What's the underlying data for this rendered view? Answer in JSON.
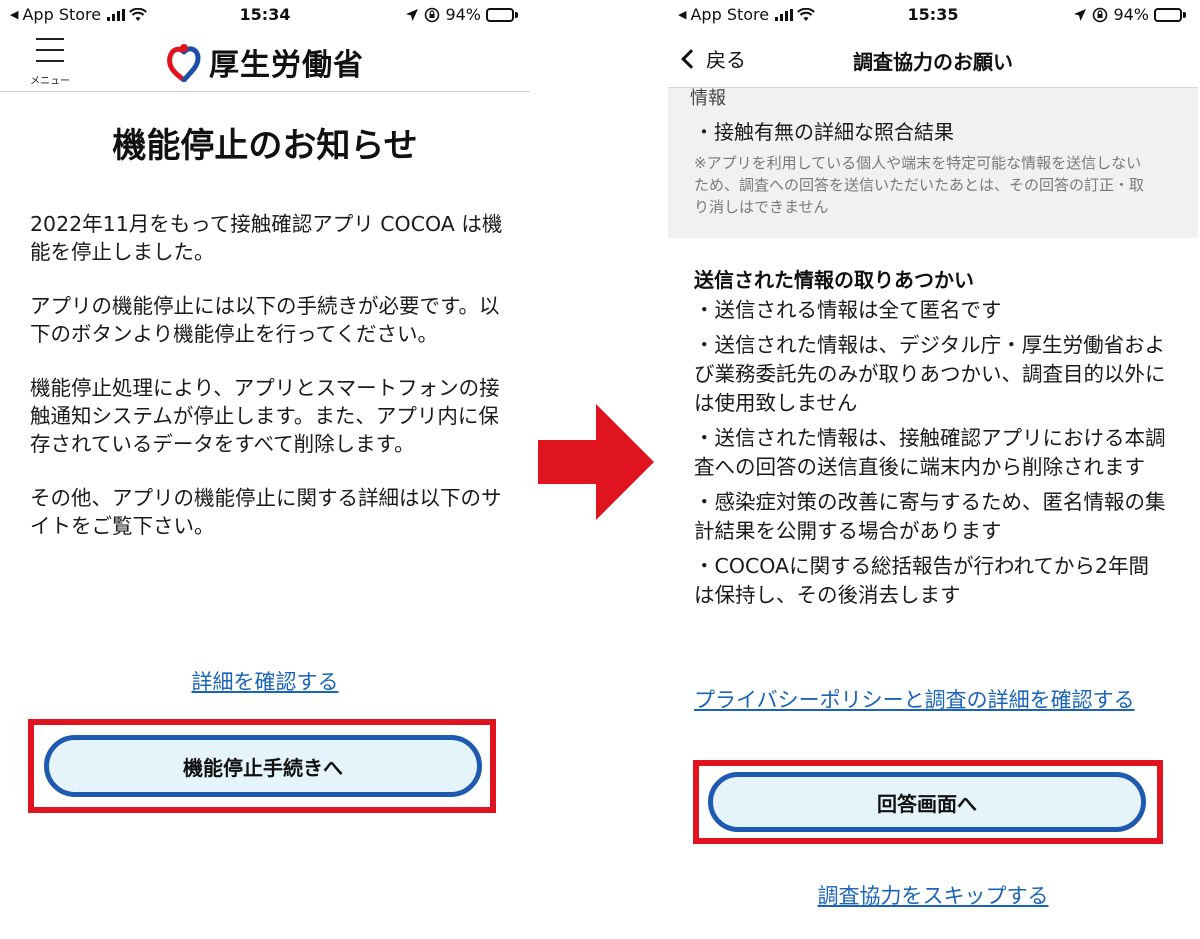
{
  "left_screen": {
    "status": {
      "back_app": "App Store",
      "time": "15:34",
      "battery": "94%",
      "battery_level": 0.94
    },
    "header": {
      "menu_label": "メニュー",
      "org_name": "厚生労働省"
    },
    "title": "機能停止のお知らせ",
    "paragraphs": [
      "2022年11月をもって接触確認アプリ COCOA は機能を停止しました。",
      "アプリの機能停止には以下の手続きが必要です。以下のボタンより機能停止を行ってください。",
      "機能停止処理により、アプリとスマートフォンの接触通知システムが停止します。また、アプリ内に保存されているデータをすべて削除します。",
      "その他、アプリの機能停止に関する詳細は以下のサイトをご覧下さい。"
    ],
    "details_link": "詳細を確認する",
    "primary_button": "機能停止手続きへ"
  },
  "right_screen": {
    "status": {
      "back_app": "App Store",
      "time": "15:35",
      "battery": "94%",
      "battery_level": 0.94
    },
    "nav": {
      "back_label": "戻る",
      "title": "調査協力のお願い"
    },
    "cut_off_text": "情報",
    "faded_item": "・接触有無の詳細な照合結果",
    "faded_note": "※アプリを利用している個人や端末を特定可能な情報を送信しないため、調査への回答を送信いただいたあとは、その回答の訂正・取り消しはできません",
    "section_heading": "送信された情報の取りあつかい",
    "bullets": [
      "・送信される情報は全て匿名です",
      "・送信された情報は、デジタル庁・厚生労働省および業務委託先のみが取りあつかい、調査目的以外には使用致しません",
      "・送信された情報は、接触確認アプリにおける本調査への回答の送信直後に端末内から削除されます",
      "・感染症対策の改善に寄与するため、匿名情報の集計結果を公開する場合があります",
      "・COCOAに関する総括報告が行われてから2年間は保持し、その後消去します"
    ],
    "privacy_link": "プライバシーポリシーと調査の詳細を確認する",
    "primary_button": "回答画面へ",
    "skip_link": "調査協力をスキップする"
  },
  "colors": {
    "highlight_red": "#e0141e",
    "button_border": "#1e5ab0",
    "button_fill": "#e5f4fb",
    "link": "#1a64b8",
    "arrow": "#e0141e"
  }
}
